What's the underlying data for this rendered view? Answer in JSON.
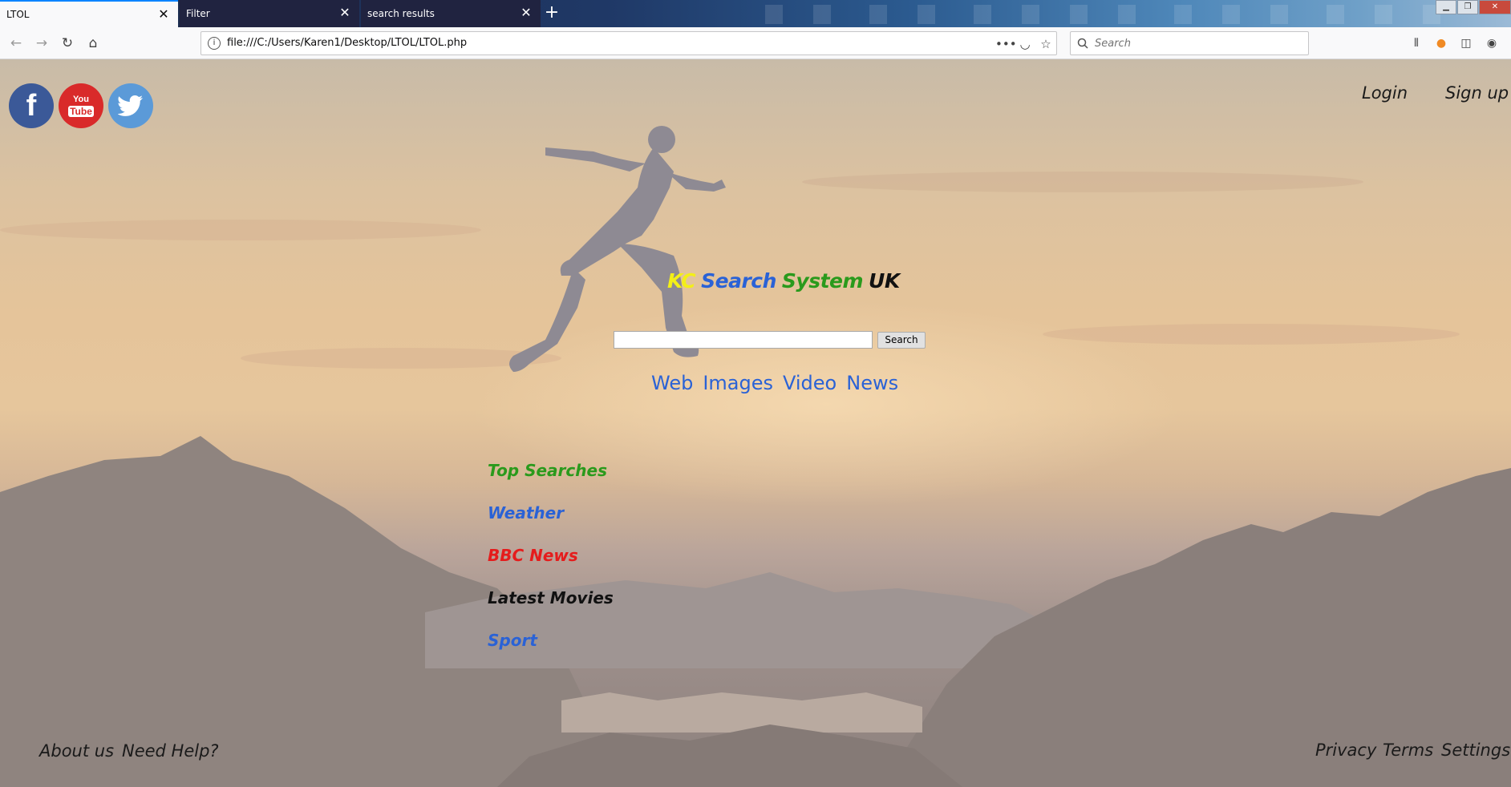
{
  "browser": {
    "tabs": [
      {
        "label": "LTOL",
        "active": true
      },
      {
        "label": "Filter",
        "active": false
      },
      {
        "label": "search results",
        "active": false
      }
    ],
    "url": "file:///C:/Users/Karen1/Desktop/LTOL/LTOL.php",
    "search_placeholder": "Search"
  },
  "header": {
    "social": [
      "facebook",
      "youtube",
      "twitter"
    ],
    "youtube_text": {
      "you": "You",
      "tube": "Tube"
    },
    "login": "Login",
    "signup": "Sign up"
  },
  "brand": {
    "parts": [
      {
        "text": "KC",
        "color": "#f3ef17"
      },
      {
        "text": "Search",
        "color": "#2a62d6"
      },
      {
        "text": "System",
        "color": "#2a9a1c"
      },
      {
        "text": "UK",
        "color": "#111111"
      }
    ]
  },
  "search": {
    "value": "",
    "button": "Search",
    "categories": [
      "Web",
      "Images",
      "Video",
      "News"
    ]
  },
  "quick_links": [
    {
      "label": "Top Searches",
      "color": "#2a9a1c"
    },
    {
      "label": "Weather",
      "color": "#2a62d6"
    },
    {
      "label": "BBC News",
      "color": "#e51c1c"
    },
    {
      "label": "Latest Movies",
      "color": "#111111"
    },
    {
      "label": "Sport",
      "color": "#2a62d6"
    }
  ],
  "footer": {
    "left": [
      "About us",
      "Need Help?"
    ],
    "right": [
      "Privacy",
      "Terms",
      "Settings"
    ]
  }
}
